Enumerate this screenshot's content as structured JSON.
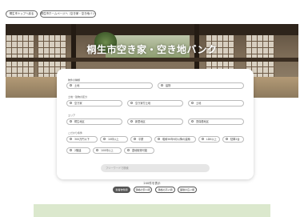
{
  "top_nav": {
    "btn1": "桐生市トップへ戻る",
    "btn2": "桐生市ホームページへ（空き家・空き地バンク）"
  },
  "hero": {
    "title": "桐生市空き家・空き地バンク"
  },
  "search": {
    "type": {
      "label": "物件の種類",
      "options": [
        "土地",
        "建物"
      ]
    },
    "zoning": {
      "label": "土地・建物の区分",
      "options": [
        "空き家",
        "空き家付土地",
        "土地"
      ]
    },
    "area": {
      "label": "エリア",
      "options": [
        "桐生地区",
        "新里地区",
        "黒保根地区"
      ]
    },
    "conditions": {
      "label": "こだわり条件",
      "options": [
        "300万円以下",
        "10坪以上",
        "平屋",
        "昭和56年6月以降の建築",
        "LDK以上",
        "駐車2台",
        "2階建",
        "100坪以上",
        "農地取得可能"
      ]
    },
    "keyword_placeholder": "フリーワードで検索"
  },
  "results": {
    "count": "240件を表示"
  },
  "sort": {
    "options": [
      "新着物件順",
      "価格の安い順",
      "価格の高い順",
      "面積の広い順"
    ]
  }
}
